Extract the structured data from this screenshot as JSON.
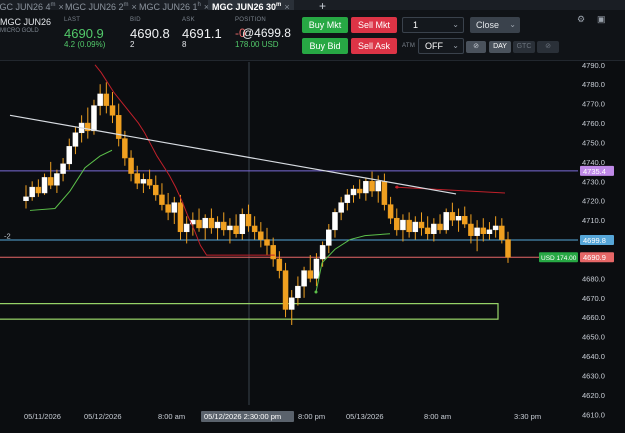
{
  "tabs": [
    {
      "label": "MGC JUN26 4",
      "sup": "m"
    },
    {
      "label": "MGC JUN26 2",
      "sup": "m"
    },
    {
      "label": "MGC JUN26 1",
      "sup": "h"
    },
    {
      "label": "MGC JUN26 30",
      "sup": "m",
      "active": true
    }
  ],
  "tab_close": "×",
  "tab_add": "+",
  "quote": {
    "symbol": "MGC JUN26",
    "description": "MICRO GOLD",
    "last_label": "LAST",
    "last": "4690.9",
    "change": "4.2 (0.09%)",
    "bid_label": "BID",
    "bid": "4690.8",
    "bid_size": "2",
    "ask_label": "ASK",
    "ask": "4691.1",
    "ask_size": "8",
    "position_label": "POSITION",
    "position_qty": "-0",
    "position_price": "@4699.8",
    "position_pnl": "178.00 USD"
  },
  "trade": {
    "buy_mkt": "Buy Mkt",
    "sell_mkt": "Sell Mkt",
    "buy_bid": "Buy Bid",
    "sell_ask": "Sell Ask",
    "quantity": "1",
    "close": "Close",
    "atm_label": "ATM",
    "atm_value": "OFF",
    "tif": [
      "DAY",
      "GTC"
    ],
    "tif_selected": "DAY"
  },
  "toolbar": {
    "timeframe": "30"
  },
  "crosshair_label": "05/12/2026 2:30:00 pm",
  "position_label": "USD 174.00",
  "left_marker": "-2",
  "colors": {
    "up": "#f0a020",
    "down": "#f0a020",
    "last_line": "#e66767",
    "position_line": "#56a6d8",
    "trail_stop_red": "#c0202a",
    "trail_stop_green": "#5cc04a",
    "channel": "#9ad86a",
    "resistance": "#7b6bd8",
    "trendline": "#d8dce2"
  },
  "chart_data": {
    "type": "candlestick",
    "y_ticks": [
      4790.0,
      4780.0,
      4770.0,
      4760.0,
      4750.0,
      4740.0,
      4730.0,
      4720.0,
      4710.0,
      4700.0,
      4690.0,
      4680.0,
      4670.0,
      4660.0,
      4650.0,
      4640.0,
      4630.0,
      4620.0,
      4610.0
    ],
    "ylim": [
      4605,
      4793
    ],
    "x_ticks": [
      "05/11/2026",
      "05/12/2026",
      "8:00 am",
      "8:00 pm",
      "05/13/2026",
      "8:00 am",
      "3:30 pm"
    ],
    "price_tags": [
      {
        "value": "4735.4",
        "color": "#c08ae8",
        "text_color": "#ffffff"
      },
      {
        "value": "4699.8",
        "color": "#56a6d8",
        "text_color": "#ffffff"
      },
      {
        "value": "4690.9",
        "color": "#e66767",
        "text_color": "#ffffff"
      }
    ],
    "candles": [
      {
        "o": 4720,
        "h": 4728,
        "l": 4716,
        "c": 4722
      },
      {
        "o": 4722,
        "h": 4730,
        "l": 4720,
        "c": 4727
      },
      {
        "o": 4727,
        "h": 4731,
        "l": 4722,
        "c": 4724
      },
      {
        "o": 4724,
        "h": 4734,
        "l": 4723,
        "c": 4732
      },
      {
        "o": 4732,
        "h": 4740,
        "l": 4726,
        "c": 4728
      },
      {
        "o": 4728,
        "h": 4736,
        "l": 4724,
        "c": 4734
      },
      {
        "o": 4734,
        "h": 4742,
        "l": 4730,
        "c": 4739
      },
      {
        "o": 4739,
        "h": 4752,
        "l": 4736,
        "c": 4748
      },
      {
        "o": 4748,
        "h": 4758,
        "l": 4744,
        "c": 4755
      },
      {
        "o": 4755,
        "h": 4764,
        "l": 4750,
        "c": 4760
      },
      {
        "o": 4760,
        "h": 4768,
        "l": 4752,
        "c": 4756
      },
      {
        "o": 4756,
        "h": 4772,
        "l": 4754,
        "c": 4769
      },
      {
        "o": 4769,
        "h": 4780,
        "l": 4764,
        "c": 4775
      },
      {
        "o": 4775,
        "h": 4781,
        "l": 4765,
        "c": 4769
      },
      {
        "o": 4769,
        "h": 4776,
        "l": 4760,
        "c": 4764
      },
      {
        "o": 4764,
        "h": 4770,
        "l": 4748,
        "c": 4752
      },
      {
        "o": 4752,
        "h": 4756,
        "l": 4738,
        "c": 4742
      },
      {
        "o": 4742,
        "h": 4746,
        "l": 4730,
        "c": 4734
      },
      {
        "o": 4734,
        "h": 4738,
        "l": 4726,
        "c": 4729
      },
      {
        "o": 4729,
        "h": 4734,
        "l": 4724,
        "c": 4731
      },
      {
        "o": 4731,
        "h": 4736,
        "l": 4726,
        "c": 4728
      },
      {
        "o": 4728,
        "h": 4733,
        "l": 4720,
        "c": 4723
      },
      {
        "o": 4723,
        "h": 4729,
        "l": 4715,
        "c": 4718
      },
      {
        "o": 4718,
        "h": 4724,
        "l": 4710,
        "c": 4714
      },
      {
        "o": 4714,
        "h": 4722,
        "l": 4708,
        "c": 4719
      },
      {
        "o": 4719,
        "h": 4723,
        "l": 4700,
        "c": 4704
      },
      {
        "o": 4704,
        "h": 4712,
        "l": 4698,
        "c": 4708
      },
      {
        "o": 4708,
        "h": 4714,
        "l": 4702,
        "c": 4710
      },
      {
        "o": 4710,
        "h": 4716,
        "l": 4704,
        "c": 4706
      },
      {
        "o": 4706,
        "h": 4713,
        "l": 4700,
        "c": 4711
      },
      {
        "o": 4711,
        "h": 4716,
        "l": 4703,
        "c": 4706
      },
      {
        "o": 4706,
        "h": 4712,
        "l": 4700,
        "c": 4709
      },
      {
        "o": 4709,
        "h": 4714,
        "l": 4702,
        "c": 4705
      },
      {
        "o": 4705,
        "h": 4711,
        "l": 4698,
        "c": 4707
      },
      {
        "o": 4707,
        "h": 4713,
        "l": 4701,
        "c": 4703
      },
      {
        "o": 4703,
        "h": 4716,
        "l": 4700,
        "c": 4713
      },
      {
        "o": 4713,
        "h": 4718,
        "l": 4704,
        "c": 4707
      },
      {
        "o": 4707,
        "h": 4712,
        "l": 4700,
        "c": 4704
      },
      {
        "o": 4704,
        "h": 4709,
        "l": 4696,
        "c": 4700
      },
      {
        "o": 4700,
        "h": 4706,
        "l": 4692,
        "c": 4697
      },
      {
        "o": 4697,
        "h": 4701,
        "l": 4686,
        "c": 4690
      },
      {
        "o": 4690,
        "h": 4694,
        "l": 4680,
        "c": 4684
      },
      {
        "o": 4684,
        "h": 4688,
        "l": 4660,
        "c": 4664
      },
      {
        "o": 4664,
        "h": 4674,
        "l": 4656,
        "c": 4670
      },
      {
        "o": 4670,
        "h": 4681,
        "l": 4666,
        "c": 4676
      },
      {
        "o": 4676,
        "h": 4686,
        "l": 4670,
        "c": 4684
      },
      {
        "o": 4684,
        "h": 4692,
        "l": 4678,
        "c": 4680
      },
      {
        "o": 4680,
        "h": 4693,
        "l": 4676,
        "c": 4690
      },
      {
        "o": 4690,
        "h": 4699,
        "l": 4686,
        "c": 4697
      },
      {
        "o": 4697,
        "h": 4708,
        "l": 4693,
        "c": 4705
      },
      {
        "o": 4705,
        "h": 4716,
        "l": 4701,
        "c": 4714
      },
      {
        "o": 4714,
        "h": 4722,
        "l": 4710,
        "c": 4719
      },
      {
        "o": 4719,
        "h": 4726,
        "l": 4715,
        "c": 4723
      },
      {
        "o": 4723,
        "h": 4728,
        "l": 4719,
        "c": 4726
      },
      {
        "o": 4726,
        "h": 4731,
        "l": 4721,
        "c": 4724
      },
      {
        "o": 4724,
        "h": 4732,
        "l": 4720,
        "c": 4730
      },
      {
        "o": 4730,
        "h": 4735,
        "l": 4722,
        "c": 4725
      },
      {
        "o": 4725,
        "h": 4733,
        "l": 4719,
        "c": 4730
      },
      {
        "o": 4730,
        "h": 4734,
        "l": 4715,
        "c": 4718
      },
      {
        "o": 4718,
        "h": 4722,
        "l": 4708,
        "c": 4711
      },
      {
        "o": 4711,
        "h": 4716,
        "l": 4702,
        "c": 4705
      },
      {
        "o": 4705,
        "h": 4713,
        "l": 4699,
        "c": 4710
      },
      {
        "o": 4710,
        "h": 4714,
        "l": 4701,
        "c": 4704
      },
      {
        "o": 4704,
        "h": 4712,
        "l": 4700,
        "c": 4709
      },
      {
        "o": 4709,
        "h": 4714,
        "l": 4702,
        "c": 4706
      },
      {
        "o": 4706,
        "h": 4712,
        "l": 4700,
        "c": 4703
      },
      {
        "o": 4703,
        "h": 4711,
        "l": 4699,
        "c": 4708
      },
      {
        "o": 4708,
        "h": 4713,
        "l": 4703,
        "c": 4705
      },
      {
        "o": 4705,
        "h": 4716,
        "l": 4703,
        "c": 4714
      },
      {
        "o": 4714,
        "h": 4719,
        "l": 4707,
        "c": 4710
      },
      {
        "o": 4710,
        "h": 4716,
        "l": 4704,
        "c": 4712
      },
      {
        "o": 4712,
        "h": 4717,
        "l": 4706,
        "c": 4708
      },
      {
        "o": 4708,
        "h": 4713,
        "l": 4698,
        "c": 4702
      },
      {
        "o": 4702,
        "h": 4710,
        "l": 4694,
        "c": 4706
      },
      {
        "o": 4706,
        "h": 4711,
        "l": 4699,
        "c": 4703
      },
      {
        "o": 4703,
        "h": 4709,
        "l": 4700,
        "c": 4705
      },
      {
        "o": 4705,
        "h": 4712,
        "l": 4701,
        "c": 4707
      },
      {
        "o": 4707,
        "h": 4711,
        "l": 4698,
        "c": 4700
      },
      {
        "o": 4700,
        "h": 4704,
        "l": 4688,
        "c": 4690.9
      }
    ],
    "trail_stop_red": [
      4790,
      4786,
      4781,
      4776,
      4772,
      4768,
      4764,
      4760,
      4755,
      4749,
      4743,
      4738,
      4733,
      4727,
      4720,
      4712,
      4705,
      4697,
      4692,
      4692,
      4692,
      4692,
      4692,
      4692,
      4692,
      4692,
      4692,
      4692,
      4692,
      4692
    ],
    "trail_stop_green": [
      4714,
      4714,
      4716,
      4720,
      4727,
      4734,
      4740,
      4744,
      4746,
      4744,
      4742,
      4738,
      4733,
      4726,
      4718
    ],
    "trendline": [
      [
        4764,
        0
      ],
      [
        4723,
        1
      ]
    ],
    "resistance_line": 4735.4,
    "position_line": 4699.8,
    "last_line": 4690.9,
    "support_zone": [
      4659,
      4667
    ]
  }
}
